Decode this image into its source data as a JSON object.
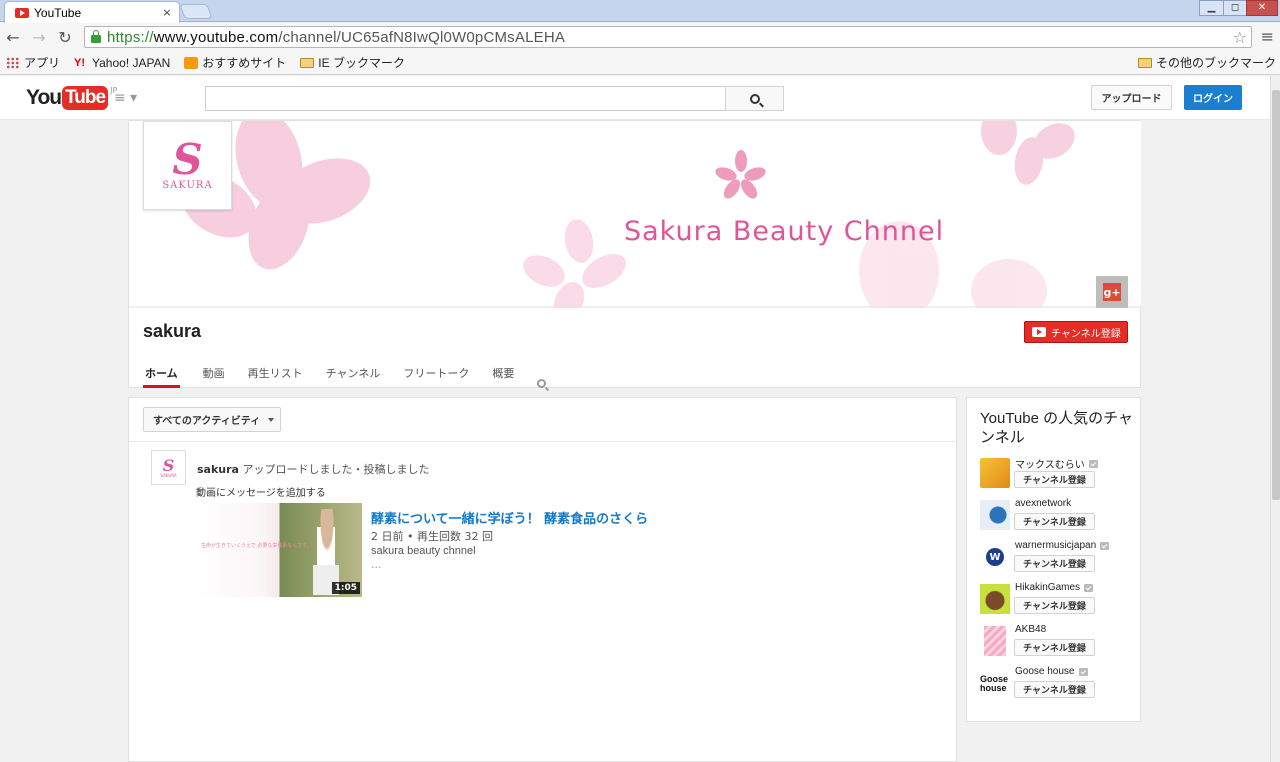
{
  "browser": {
    "tab_title": "YouTube",
    "tab_close": "×",
    "url_scheme": "https://",
    "url_host": "www.youtube.com",
    "url_path": "/channel/UC65afN8IwQl0W0pCMsALEHA",
    "back": "←",
    "forward": "→",
    "reload": "↻",
    "star": "☆",
    "menu": "≡",
    "win_min": "▁",
    "win_max": "◻",
    "win_close": "✕"
  },
  "bookmarks": {
    "items": [
      {
        "label": "アプリ",
        "icon": "apps-icon"
      },
      {
        "label": "Yahoo! JAPAN",
        "icon": "yahoo-icon"
      },
      {
        "label": "おすすめサイト",
        "icon": "star-icon"
      },
      {
        "label": "IE ブックマーク",
        "icon": "folder-icon"
      }
    ],
    "other": "その他のブックマーク",
    "yahoo_glyph": "Y!"
  },
  "youtube": {
    "logo_you": "You",
    "logo_tube": "Tube",
    "logo_region": "JP",
    "guide_icon": "≡ ▾",
    "search_placeholder": "",
    "upload_label": "アップロード",
    "login_label": "ログイン",
    "accent_color": "#e52d27",
    "login_color": "#1b7fd1"
  },
  "channel": {
    "banner_title": "Sakura Beauty Chnnel",
    "avatar_letter": "S",
    "avatar_text": "SAKURA",
    "gplus_label": "g+",
    "name": "sakura",
    "subscribe_label": "チャンネル登録",
    "tabs": [
      "ホーム",
      "動画",
      "再生リスト",
      "チャンネル",
      "フリートーク",
      "概要"
    ],
    "active_tab": "ホーム",
    "brand_color": "#e0549a"
  },
  "feed": {
    "filter_label": "すべてのアクティビティ",
    "activity_user": "sakura",
    "activity_text": " アップロードしました・投稿しました",
    "message_label": "動画にメッセージを追加する",
    "video": {
      "title": "酵素について一緒に学ぼう！ 酵素食品のさくら",
      "meta": "2 日前 • 再生回数 32 回",
      "channel": "sakura beauty chnnel",
      "more": "...",
      "duration": "1:05",
      "thumb_text": "生命が生きていくうえで 必要な栄養素なんです。"
    }
  },
  "sidebar": {
    "title": "YouTube の人気のチャンネル",
    "subscribe_label": "チャンネル登録",
    "channels": [
      {
        "name": "マックスむらい",
        "verified": true
      },
      {
        "name": "avexnetwork",
        "verified": false
      },
      {
        "name": "warnermusicjapan",
        "verified": true
      },
      {
        "name": "HikakinGames",
        "verified": true
      },
      {
        "name": "AKB48",
        "verified": false
      },
      {
        "name": "Goose house",
        "verified": true
      }
    ],
    "goose_logo_top": "Goose",
    "goose_logo_bottom": "house",
    "warner_logo": "W"
  }
}
